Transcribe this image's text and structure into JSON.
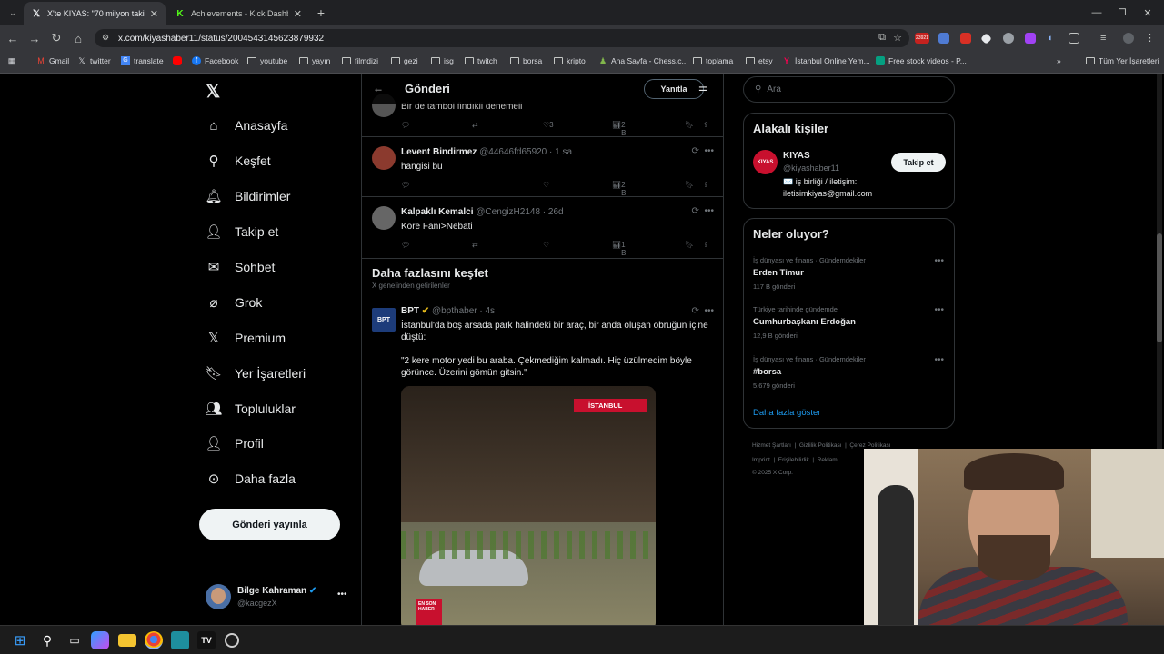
{
  "browser": {
    "tabs": [
      {
        "label": "X'te KIYAS: \"70 milyon takipçis",
        "active": true,
        "icon": "X"
      },
      {
        "label": "Achievements - Kick Dashboard",
        "active": false,
        "icon": "K"
      }
    ],
    "url": "x.com/kiyashaber11/status/2004543145623879932",
    "extension_badge": "23921",
    "bookmarks": [
      "Gmail",
      "twitter",
      "translate",
      "Facebook",
      "youtube",
      "yayın",
      "filmdizi",
      "gezi",
      "isg",
      "twitch",
      "borsa",
      "kripto",
      "Ana Sayfa - Chess.c...",
      "toplama",
      "etsy",
      "İstanbul Online Yem...",
      "Free stock videos - P..."
    ],
    "all_bookmarks": "Tüm Yer İşaretleri",
    "accent": "#8ab4f8"
  },
  "left_nav": {
    "items": [
      "Anasayfa",
      "Keşfet",
      "Bildirimler",
      "Takip et",
      "Sohbet",
      "Grok",
      "Premium",
      "Yer İşaretleri",
      "Topluluklar",
      "Profil",
      "Daha fazla"
    ],
    "post_button": "Gönderi yayınla",
    "account": {
      "name": "Bilge Kahraman",
      "handle": "@kacgezX"
    }
  },
  "center": {
    "title": "Gönderi",
    "reply_button": "Yanıtla",
    "tweets": [
      {
        "text": "Bir de tambol findıkli denemeli",
        "likes": "3",
        "views": "2 B"
      },
      {
        "name": "Levent Bindirmez",
        "handle": "@44646fd65920",
        "time": "· 1 sa",
        "text": "hangisi bu",
        "views": "2 B"
      },
      {
        "name": "Kalpaklı Kemalci",
        "handle": "@CengizH2148",
        "time": "· 26d",
        "text": "Kore Fanı>Nebati",
        "views": "1 B"
      }
    ],
    "discover": {
      "title": "Daha fazlasını keşfet",
      "subtitle": "X genelinden getirilenler"
    },
    "bpt": {
      "name": "BPT",
      "handle": "@bpthaber",
      "time": "· 4s",
      "text1": "İstanbul'da boş arsada park halindeki bir araç, bir anda oluşan obruğun içine düştü:",
      "text2": "\"2 kere motor yedi bu araba. Çekmediğim kalmadı. Hiç üzülmedim böyle görünce. Üzerini gömün gitsin.\"",
      "media_tag": "İSTANBUL",
      "corner_tag": "EN SON HABER"
    }
  },
  "right": {
    "search_placeholder": "Ara",
    "related": {
      "title": "Alakalı kişiler",
      "name": "KIYAS",
      "handle": "@kiyashaber11",
      "bio_line1": "✉️ iş birliği / iletişim:",
      "bio_line2": "iletisimkiyas@gmail.com",
      "follow": "Takip et"
    },
    "trends": {
      "title": "Neler oluyor?",
      "items": [
        {
          "context": "İş dünyası ve finans · Gündemdekiler",
          "topic": "Erden Timur",
          "count": "117 B gönderi"
        },
        {
          "context": "Türkiye tarihinde gündemde",
          "topic": "Cumhurbaşkanı Erdoğan",
          "count": "12,9 B gönderi"
        },
        {
          "context": "İş dünyası ve finans · Gündemdekiler",
          "topic": "#borsa",
          "count": "5.679 gönderi"
        }
      ],
      "show_more": "Daha fazla göster"
    },
    "footer": {
      "line1": [
        "Hizmet Şartları",
        "Gizlilik Politikası",
        "Çerez Politikası"
      ],
      "line2": [
        "Imprint",
        "Erişilebilirlik",
        "Reklam"
      ],
      "copyright": "© 2025 X Corp."
    }
  }
}
